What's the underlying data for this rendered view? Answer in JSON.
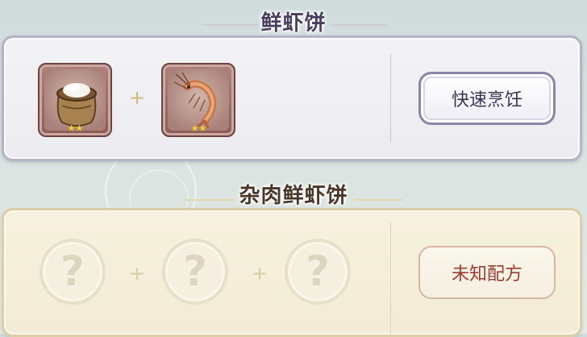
{
  "recipes": [
    {
      "title": "鲜虾饼",
      "ingredients": [
        {
          "icon": "flour-sack-icon",
          "stars": "★★"
        },
        {
          "icon": "shrimp-icon",
          "stars": "★★"
        }
      ],
      "plus": "+",
      "button_label": "快速烹饪"
    },
    {
      "title": "杂肉鲜虾饼",
      "unknown_symbol": "?",
      "plus": "+",
      "button_label": "未知配方"
    }
  ],
  "colors": {
    "card_known_border": "#b7b3c6",
    "card_unknown_bg": "#f4efdc",
    "unknown_button_text": "#9d3a2e"
  }
}
